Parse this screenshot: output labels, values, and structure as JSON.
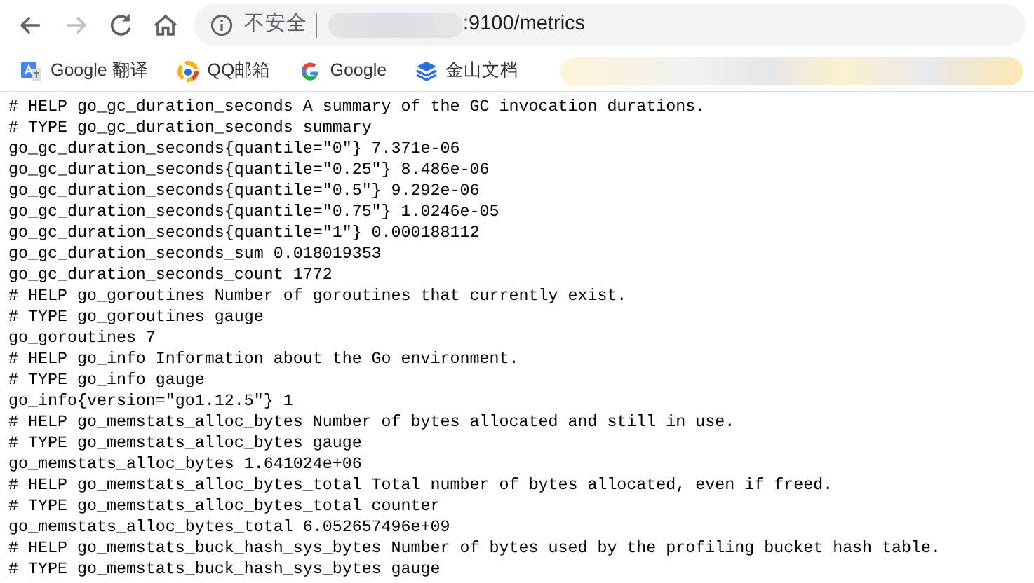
{
  "toolbar": {
    "buttons": [
      {
        "kind": "back",
        "disabled": false
      },
      {
        "kind": "forward",
        "disabled": true
      },
      {
        "kind": "reload",
        "disabled": false
      },
      {
        "kind": "home",
        "disabled": false
      }
    ],
    "address": {
      "security_label": "不安全",
      "url": ":9100/metrics"
    }
  },
  "bookmarks": [
    {
      "kind": "translate",
      "label": "Google 翻译"
    },
    {
      "kind": "qq-mail",
      "label": "QQ邮箱"
    },
    {
      "kind": "google",
      "label": "Google"
    },
    {
      "kind": "docs",
      "label": "金山文档"
    }
  ],
  "content": {
    "lines": [
      "# HELP go_gc_duration_seconds A summary of the GC invocation durations.",
      "# TYPE go_gc_duration_seconds summary",
      "go_gc_duration_seconds{quantile=\"0\"} 7.371e-06",
      "go_gc_duration_seconds{quantile=\"0.25\"} 8.486e-06",
      "go_gc_duration_seconds{quantile=\"0.5\"} 9.292e-06",
      "go_gc_duration_seconds{quantile=\"0.75\"} 1.0246e-05",
      "go_gc_duration_seconds{quantile=\"1\"} 0.000188112",
      "go_gc_duration_seconds_sum 0.018019353",
      "go_gc_duration_seconds_count 1772",
      "# HELP go_goroutines Number of goroutines that currently exist.",
      "# TYPE go_goroutines gauge",
      "go_goroutines 7",
      "# HELP go_info Information about the Go environment.",
      "# TYPE go_info gauge",
      "go_info{version=\"go1.12.5\"} 1",
      "# HELP go_memstats_alloc_bytes Number of bytes allocated and still in use.",
      "# TYPE go_memstats_alloc_bytes gauge",
      "go_memstats_alloc_bytes 1.641024e+06",
      "# HELP go_memstats_alloc_bytes_total Total number of bytes allocated, even if freed.",
      "# TYPE go_memstats_alloc_bytes_total counter",
      "go_memstats_alloc_bytes_total 6.052657496e+09",
      "# HELP go_memstats_buck_hash_sys_bytes Number of bytes used by the profiling bucket hash table.",
      "# TYPE go_memstats_buck_hash_sys_bytes gauge"
    ]
  }
}
